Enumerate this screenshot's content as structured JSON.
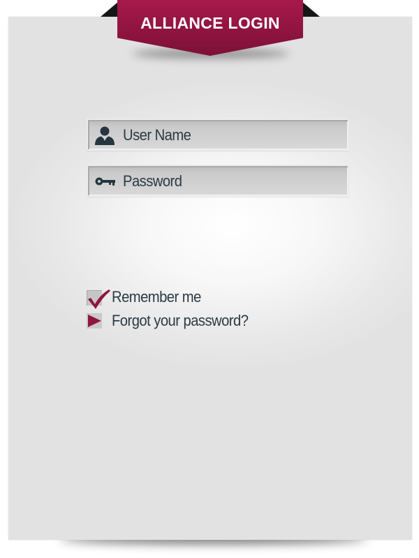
{
  "banner": {
    "title": "ALLIANCE LOGIN"
  },
  "form": {
    "username": {
      "placeholder": "User Name",
      "icon": "user-icon"
    },
    "password": {
      "placeholder": "Password",
      "icon": "key-icon"
    }
  },
  "options": {
    "remember_label": "Remember me",
    "remember_checked": true,
    "forgot_label": "Forgot your password?"
  },
  "colors": {
    "accent": "#8f1440",
    "text": "#2b3a44",
    "icon": "#25363f",
    "card": "#ebebeb"
  }
}
